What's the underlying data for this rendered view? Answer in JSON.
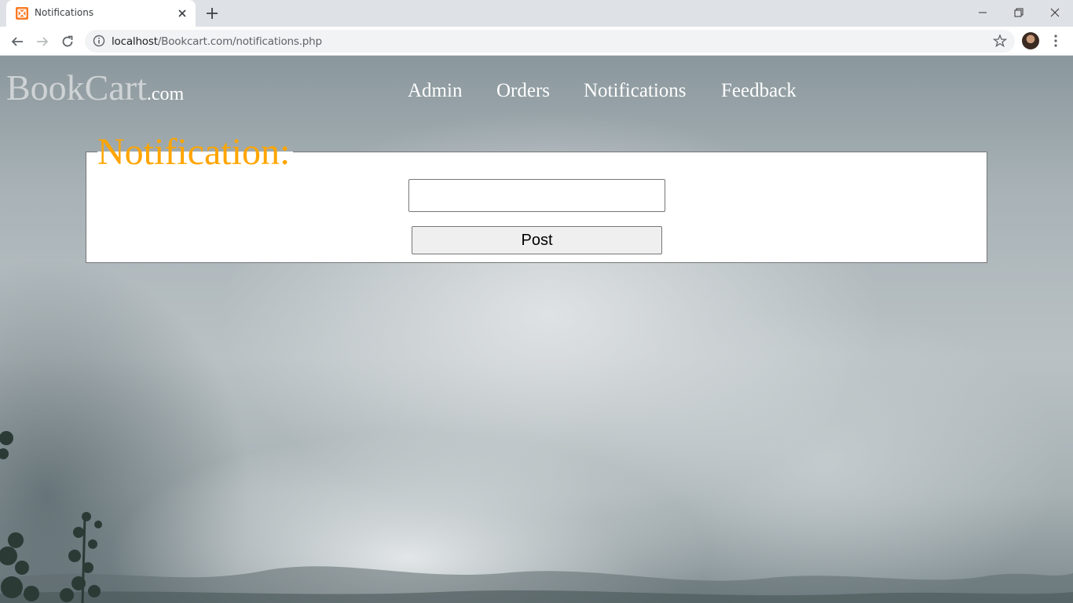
{
  "browser": {
    "tab_title": "Notifications",
    "url_host": "localhost",
    "url_path": "/Bookcart.com/notifications.php"
  },
  "site": {
    "logo_main": "BookCart",
    "logo_suffix": ".com",
    "nav": [
      "Admin",
      "Orders",
      "Notifications",
      "Feedback"
    ]
  },
  "form": {
    "heading": "Notification:",
    "input_value": "",
    "post_label": "Post"
  },
  "colors": {
    "heading": "#ffa500",
    "nav_text": "#ffffff"
  }
}
